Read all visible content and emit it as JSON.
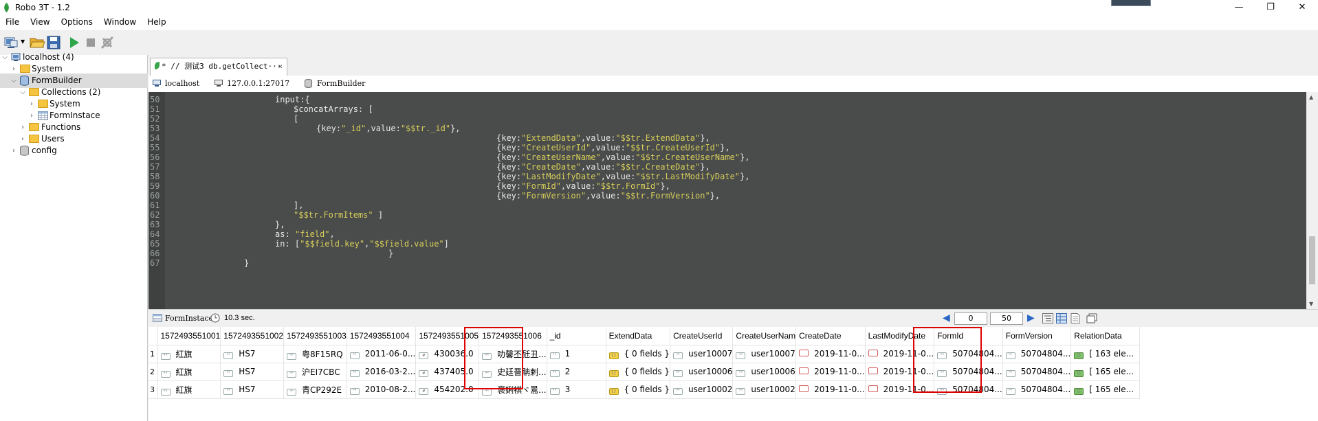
{
  "window": {
    "title": "Robo 3T - 1.2",
    "controls": [
      "—",
      "❐",
      "✕"
    ]
  },
  "menu": [
    "File",
    "View",
    "Options",
    "Window",
    "Help"
  ],
  "toolbar": {
    "icons": [
      "connect-icon",
      "open-icon",
      "save-icon",
      "run-icon",
      "stop-icon",
      "format-icon"
    ]
  },
  "tree": {
    "localhost": "localhost (4)",
    "system": "System",
    "formbuilder": "FormBuilder",
    "collections": "Collections (2)",
    "coll_system": "System",
    "forminstace": "FormInstace",
    "functions": "Functions",
    "users": "Users",
    "config": "config"
  },
  "tab": {
    "label": "* // 测试3  db.getCollect···",
    "close": "×"
  },
  "infobar": {
    "host": "localhost",
    "address": "127.0.0.1:27017",
    "db": "FormBuilder"
  },
  "editor": {
    "lines": [
      {
        "n": "50",
        "indent": 400,
        "parts": [
          [
            "input:{",
            "w"
          ]
        ]
      },
      {
        "n": "51",
        "indent": 427,
        "parts": [
          [
            "$concatArrays: [",
            "w"
          ]
        ]
      },
      {
        "n": "52",
        "indent": 427,
        "parts": [
          [
            "[",
            "w"
          ]
        ]
      },
      {
        "n": "53",
        "indent": 460,
        "parts": [
          [
            "{key:",
            "w"
          ],
          [
            "\"_id\"",
            "s"
          ],
          [
            ",value:",
            "w"
          ],
          [
            "\"$$tr._id\"",
            "s"
          ],
          [
            "},",
            "w"
          ]
        ]
      },
      {
        "n": "54",
        "indent": 722,
        "parts": [
          [
            "{key:",
            "w"
          ],
          [
            "\"ExtendData\"",
            "s"
          ],
          [
            ",value:",
            "w"
          ],
          [
            "\"$$tr.ExtendData\"",
            "s"
          ],
          [
            "},",
            "w"
          ]
        ]
      },
      {
        "n": "55",
        "indent": 722,
        "parts": [
          [
            "{key:",
            "w"
          ],
          [
            "\"CreateUserId\"",
            "s"
          ],
          [
            ",value:",
            "w"
          ],
          [
            "\"$$tr.CreateUserId\"",
            "s"
          ],
          [
            "},",
            "w"
          ]
        ]
      },
      {
        "n": "56",
        "indent": 722,
        "parts": [
          [
            "{key:",
            "w"
          ],
          [
            "\"CreateUserName\"",
            "s"
          ],
          [
            ",value:",
            "w"
          ],
          [
            "\"$$tr.CreateUserName\"",
            "s"
          ],
          [
            "},",
            "w"
          ]
        ]
      },
      {
        "n": "57",
        "indent": 722,
        "parts": [
          [
            "{key:",
            "w"
          ],
          [
            "\"CreateDate\"",
            "s"
          ],
          [
            ",value:",
            "w"
          ],
          [
            "\"$$tr.CreateDate\"",
            "s"
          ],
          [
            "},",
            "w"
          ]
        ]
      },
      {
        "n": "58",
        "indent": 722,
        "parts": [
          [
            "{key:",
            "w"
          ],
          [
            "\"LastModifyDate\"",
            "s"
          ],
          [
            ",value:",
            "w"
          ],
          [
            "\"$$tr.LastModifyDate\"",
            "s"
          ],
          [
            "},",
            "w"
          ]
        ]
      },
      {
        "n": "59",
        "indent": 722,
        "parts": [
          [
            "{key:",
            "w"
          ],
          [
            "\"FormId\"",
            "s"
          ],
          [
            ",value:",
            "w"
          ],
          [
            "\"$$tr.FormId\"",
            "s"
          ],
          [
            "},",
            "w"
          ]
        ]
      },
      {
        "n": "60",
        "indent": 722,
        "parts": [
          [
            "{key:",
            "w"
          ],
          [
            "\"FormVersion\"",
            "s"
          ],
          [
            ",value:",
            "w"
          ],
          [
            "\"$$tr.FormVersion\"",
            "s"
          ],
          [
            "},",
            "w"
          ]
        ]
      },
      {
        "n": "61",
        "indent": 427,
        "parts": [
          [
            "],",
            "w"
          ]
        ]
      },
      {
        "n": "62",
        "indent": 427,
        "parts": [
          [
            "\"$$tr.FormItems\"",
            "s"
          ],
          [
            " ]",
            "w"
          ]
        ]
      },
      {
        "n": "63",
        "indent": 400,
        "parts": [
          [
            "},",
            "w"
          ]
        ]
      },
      {
        "n": "64",
        "indent": 400,
        "parts": [
          [
            "as: ",
            "w"
          ],
          [
            "\"field\"",
            "s"
          ],
          [
            ",",
            "w"
          ]
        ]
      },
      {
        "n": "65",
        "indent": 400,
        "parts": [
          [
            "in: [",
            "w"
          ],
          [
            "\"$$field.key\"",
            "s"
          ],
          [
            ",",
            "w"
          ],
          [
            "\"$$field.value\"",
            "s"
          ],
          [
            "]",
            "w"
          ]
        ]
      },
      {
        "n": "66",
        "indent": 565,
        "parts": [
          [
            "}",
            "w"
          ]
        ]
      },
      {
        "n": "67",
        "indent": 355,
        "parts": [
          [
            "}",
            "w"
          ]
        ]
      }
    ],
    "colors": {
      "w": "#e8e8e8",
      "s": "#d6cf5a"
    }
  },
  "results": {
    "collection": "FormInstace",
    "time": "10.3 sec.",
    "page_start": "0",
    "page_size": "50"
  },
  "grid": {
    "columns": [
      "1572493551001",
      "1572493551002",
      "1572493551003",
      "1572493551004",
      "1572493551005",
      "1572493551006",
      "_id",
      "ExtendData",
      "CreateUserId",
      "CreateUserNam",
      "CreateDate",
      "LastModifyDate",
      "FormId",
      "FormVersion",
      "RelationData"
    ],
    "rows": [
      {
        "n": "1",
        "cells": [
          "紅旗",
          "HS7",
          "粤8F15RQ",
          "2011-06-0...",
          "430036.0",
          "叻馨丕瓩丑...",
          "1",
          "{ 0 fields }",
          "user10007",
          "user10007",
          "2019-11-0...",
          "2019-11-0...",
          "50704804...",
          "50704804...",
          "[ 163 ele..."
        ]
      },
      {
        "n": "2",
        "cells": [
          "紅旗",
          "HS7",
          "沪EI7CBC",
          "2016-03-2...",
          "437405.0",
          "史廷罾聃剌...",
          "2",
          "{ 0 fields }",
          "user10006",
          "user10006",
          "2019-11-0...",
          "2019-11-0...",
          "50704804...",
          "50704804...",
          "[ 165 ele..."
        ]
      },
      {
        "n": "3",
        "cells": [
          "紅旗",
          "HS7",
          "青CP292E",
          "2010-08-2...",
          "454202.0",
          "褒娳褀ヾ暠...",
          "3",
          "{ 0 fields }",
          "user10002",
          "user10002",
          "2019-11-0...",
          "2019-11-0...",
          "50704804...",
          "50704804...",
          "[ 165 ele..."
        ]
      }
    ],
    "badge_types": [
      "str",
      "str",
      "str",
      "str",
      "num",
      "str",
      "str",
      "obj",
      "str",
      "str",
      "date",
      "date",
      "str",
      "str",
      "arr"
    ]
  }
}
